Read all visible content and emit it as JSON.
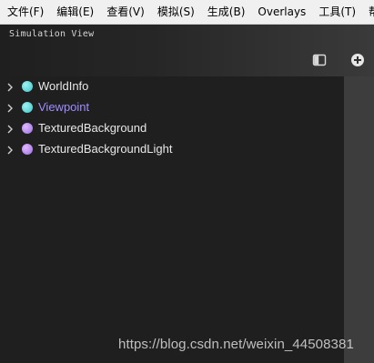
{
  "menu": {
    "items": [
      "文件(F)",
      "编辑(E)",
      "查看(V)",
      "模拟(S)",
      "生成(B)",
      "Overlays",
      "工具(T)",
      "帮"
    ]
  },
  "panel": {
    "title": "Simulation View",
    "split_icon": "split-view-icon",
    "add_icon": "add-circle-icon"
  },
  "tree": {
    "items": [
      {
        "label": "WorldInfo",
        "icon": "cyan-node-icon",
        "color": "#5fd6d6",
        "selected": false
      },
      {
        "label": "Viewpoint",
        "icon": "cyan-node-icon",
        "color": "#5fd6d6",
        "selected": true
      },
      {
        "label": "TexturedBackground",
        "icon": "purple-node-icon",
        "color": "#a98cf0",
        "selected": false
      },
      {
        "label": "TexturedBackgroundLight",
        "icon": "purple-node-icon",
        "color": "#a98cf0",
        "selected": false
      }
    ]
  },
  "colors": {
    "selected_text": "#9f8cff",
    "background": "#1f1f1f",
    "scrollbar": "#3d3d3d"
  },
  "watermark": "https://blog.csdn.net/weixin_44508381"
}
